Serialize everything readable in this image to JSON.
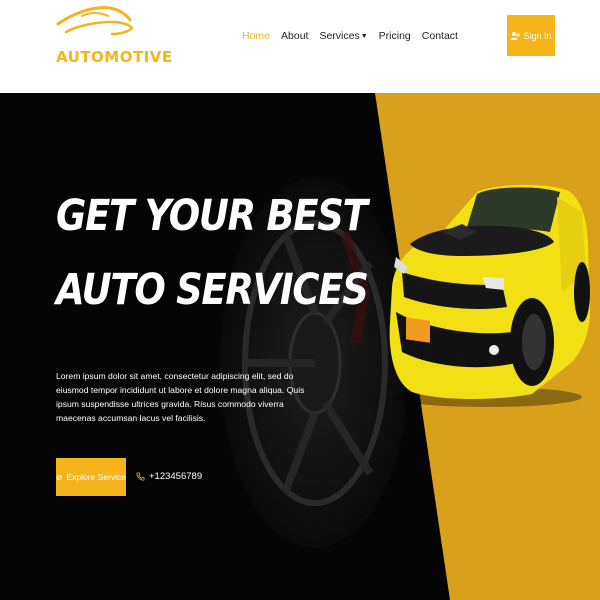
{
  "brand": {
    "name": "AUTOMOTIVE"
  },
  "nav": {
    "items": [
      {
        "label": "Home",
        "active": true
      },
      {
        "label": "About"
      },
      {
        "label": "Services",
        "has_dropdown": true
      },
      {
        "label": "Pricing"
      },
      {
        "label": "Contact"
      }
    ],
    "signin_label": "Sign In"
  },
  "hero": {
    "headline_line1": "GET YOUR BEST",
    "headline_line2": "AUTO SERVICES",
    "description": "Lorem ipsum dolor sit amet, consectetur adipiscing elit, sed do eiusmod tempor incididunt ut labore et dolore magna aliqua. Quis ipsum suspendisse ultrices gravida. Risus commodo viverra maecenas accumsan lacus vel facilisis.",
    "cta_label": "Explore Service",
    "phone": "+123456789"
  },
  "colors": {
    "accent": "#f4b41a",
    "hero_yellow": "#d9a01c",
    "hero_dark": "#050505"
  },
  "icons": {
    "signin": "user-plus-icon",
    "cta": "tools-icon",
    "phone": "phone-icon",
    "dropdown": "caret-down-icon"
  }
}
